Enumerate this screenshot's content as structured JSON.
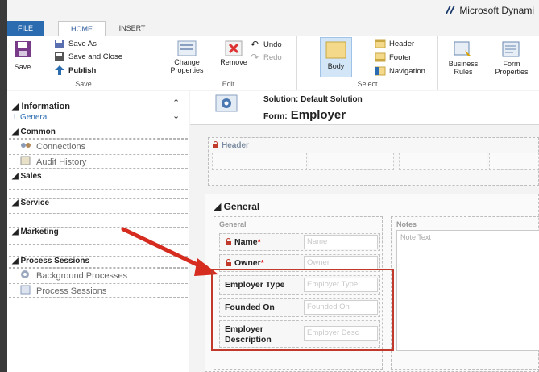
{
  "app": {
    "brand": "Microsoft Dynami"
  },
  "tabs": [
    {
      "label": "FILE"
    },
    {
      "label": "HOME"
    },
    {
      "label": "INSERT"
    }
  ],
  "ribbon": {
    "save": {
      "label": "Save"
    },
    "save_as": "Save As",
    "save_and_close": "Save and Close",
    "publish": "Publish",
    "group_save": "Save",
    "change_properties": "Change Properties",
    "remove": "Remove",
    "undo": "Undo",
    "redo": "Redo",
    "group_edit": "Edit",
    "body": "Body",
    "header": "Header",
    "footer": "Footer",
    "navigation": "Navigation",
    "group_select": "Select",
    "business_rules": "Business Rules",
    "form_properties": "Form Properties"
  },
  "nav": {
    "information": "Information",
    "general": "General",
    "sections": [
      {
        "title": "Common",
        "items": [
          "Connections",
          "Audit History"
        ]
      },
      {
        "title": "Sales",
        "items": []
      },
      {
        "title": "Service",
        "items": []
      },
      {
        "title": "Marketing",
        "items": []
      },
      {
        "title": "Process Sessions",
        "items": [
          "Background Processes",
          "Process Sessions"
        ]
      }
    ]
  },
  "form": {
    "solution_label": "Solution:",
    "solution_name": "Default Solution",
    "form_label": "Form:",
    "form_name": "Employer",
    "header_label": "Header",
    "general_title": "General",
    "general_col_label": "General",
    "notes_label": "Notes",
    "notes_placeholder": "Note Text",
    "fields": [
      {
        "label": "Name",
        "required": "*",
        "placeholder": "Name",
        "locked": true
      },
      {
        "label": "Owner",
        "required": "*",
        "placeholder": "Owner",
        "locked": true
      },
      {
        "label": "Employer Type",
        "required": "",
        "placeholder": "Employer Type",
        "locked": false
      },
      {
        "label": "Founded On",
        "required": "",
        "placeholder": "Founded On",
        "locked": false
      },
      {
        "label": "Employer Description",
        "required": "",
        "placeholder": "Employer Desc",
        "locked": false
      }
    ]
  },
  "colors": {
    "accent": "#2b6cb0",
    "highlight": "#c0392b",
    "required": "#dd0000"
  }
}
